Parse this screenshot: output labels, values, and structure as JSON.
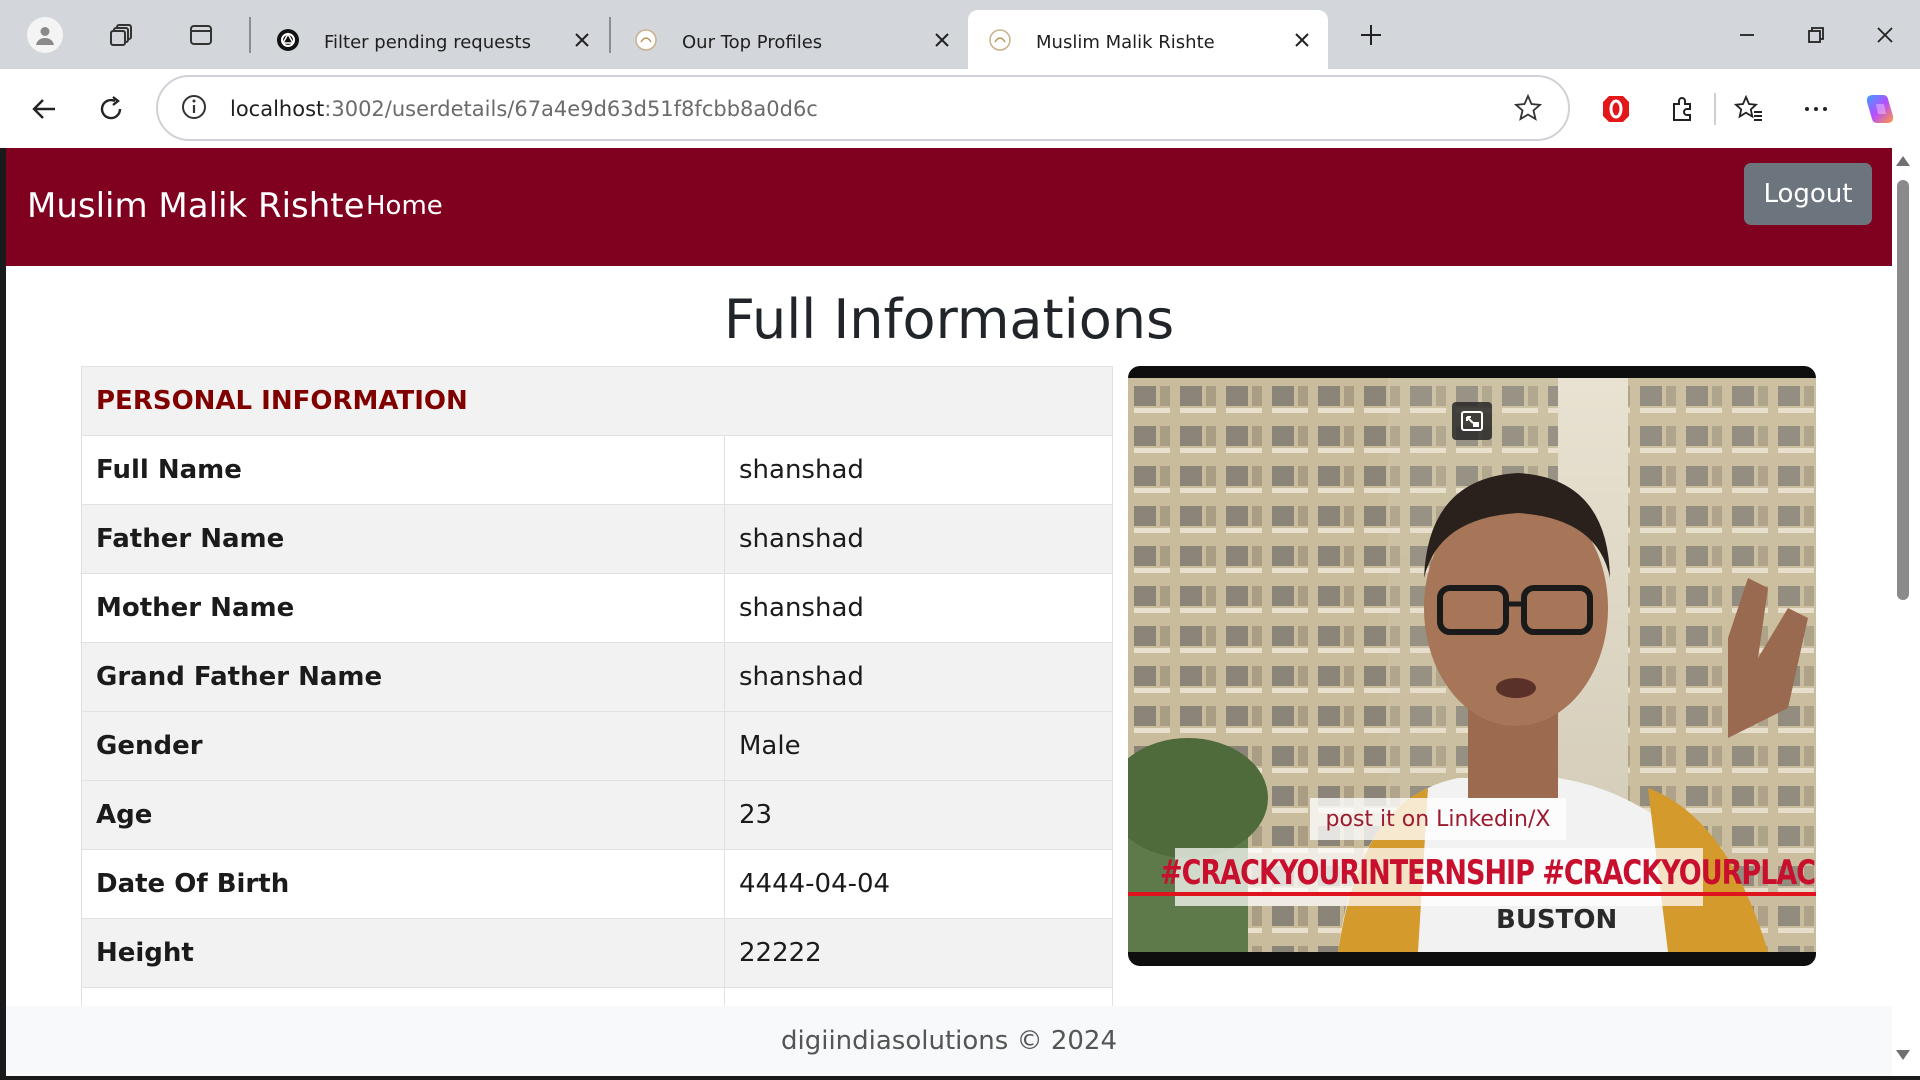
{
  "browser": {
    "tabs": [
      {
        "title": "Filter pending requests",
        "icon": "chatgpt-icon"
      },
      {
        "title": "Our Top Profiles",
        "icon": "site-favicon"
      },
      {
        "title": "Muslim Malik Rishte",
        "icon": "site-favicon",
        "active": true
      }
    ],
    "address": {
      "host": "localhost",
      "path": ":3002/userdetails/67a4e9d63d51f8fcbb8a0d6c"
    },
    "toolbar_icons": [
      "back-icon",
      "refresh-icon",
      "site-info-icon",
      "favorite-star-icon",
      "opera-icon",
      "extensions-icon",
      "favorites-icon",
      "more-icon",
      "copilot-icon"
    ]
  },
  "navbar": {
    "brand": "Muslim Malik Rishte",
    "home_label": "Home",
    "logout_label": "Logout",
    "bg_color": "#800020"
  },
  "page": {
    "title": "Full Informations"
  },
  "personal_info": {
    "section_title": "PERSONAL INFORMATION",
    "rows": [
      {
        "label": "Full Name",
        "value": "shanshad"
      },
      {
        "label": "Father Name",
        "value": "shanshad"
      },
      {
        "label": "Mother Name",
        "value": "shanshad"
      },
      {
        "label": "Grand Father Name",
        "value": "shanshad"
      },
      {
        "label": "Gender",
        "value": "Male"
      },
      {
        "label": "Age",
        "value": "23"
      },
      {
        "label": "Date Of Birth",
        "value": "4444-04-04"
      },
      {
        "label": "Height",
        "value": "22222"
      }
    ]
  },
  "video": {
    "caption_1": "post it on Linkedin/X",
    "caption_2": "#CRACKYOURINTERNSHIP #CRACKYOURPLACEMENT",
    "shirt_text": "BUSTON"
  },
  "footer": {
    "text": "digiindiasolutions © 2024"
  }
}
